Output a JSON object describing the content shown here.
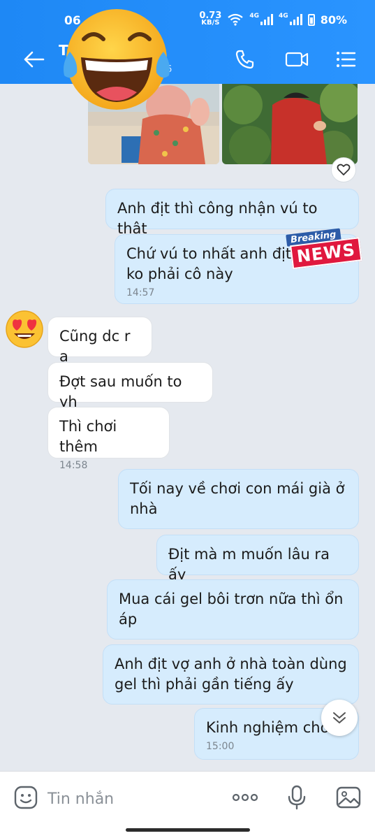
{
  "status_bar": {
    "time": "06",
    "net_speed_value": "0.73",
    "net_speed_unit": "KB/S",
    "net1": "4G",
    "net2": "4G",
    "battery": "80%"
  },
  "header": {
    "contact_name": "T",
    "contact_sub": "6",
    "accent": "#2a94ff"
  },
  "icons": {
    "back": "back-arrow-icon",
    "call": "phone-icon",
    "video": "video-icon",
    "menu": "list-menu-icon",
    "emoji": "emoji-icon",
    "more": "more-dots-icon",
    "mic": "microphone-icon",
    "image": "image-icon"
  },
  "sticker": {
    "breaking_top": "Breaking",
    "breaking_main": "NEWS"
  },
  "messages": [
    {
      "side": "me",
      "text": "Anh địt thì công nhận vú to thật",
      "time": ""
    },
    {
      "side": "me",
      "text": "Chứ vú to nhất anh địt hồ thì ko phải cô này",
      "time": "14:57"
    },
    {
      "side": "them",
      "text": "Cũng dc r a",
      "time": ""
    },
    {
      "side": "them",
      "text": "Đợt sau muốn to yh",
      "time": ""
    },
    {
      "side": "them",
      "text": "Thì chơi thêm",
      "time": "14:58"
    },
    {
      "side": "me",
      "text": "Tối nay về chơi con mái già ở nhà",
      "time": ""
    },
    {
      "side": "me",
      "text": "Địt mà m muốn lâu ra ấy",
      "time": ""
    },
    {
      "side": "me",
      "text": "Mua cái gel bôi trơn nữa thì ổn áp",
      "time": ""
    },
    {
      "side": "me",
      "text": "Anh địt vợ anh ở nhà toàn dùng gel thì phải gần tiếng ấy",
      "time": ""
    },
    {
      "side": "me",
      "text": "Kinh nghiệm cho",
      "time": "15:00"
    }
  ],
  "input": {
    "placeholder": "Tin nhắn"
  }
}
